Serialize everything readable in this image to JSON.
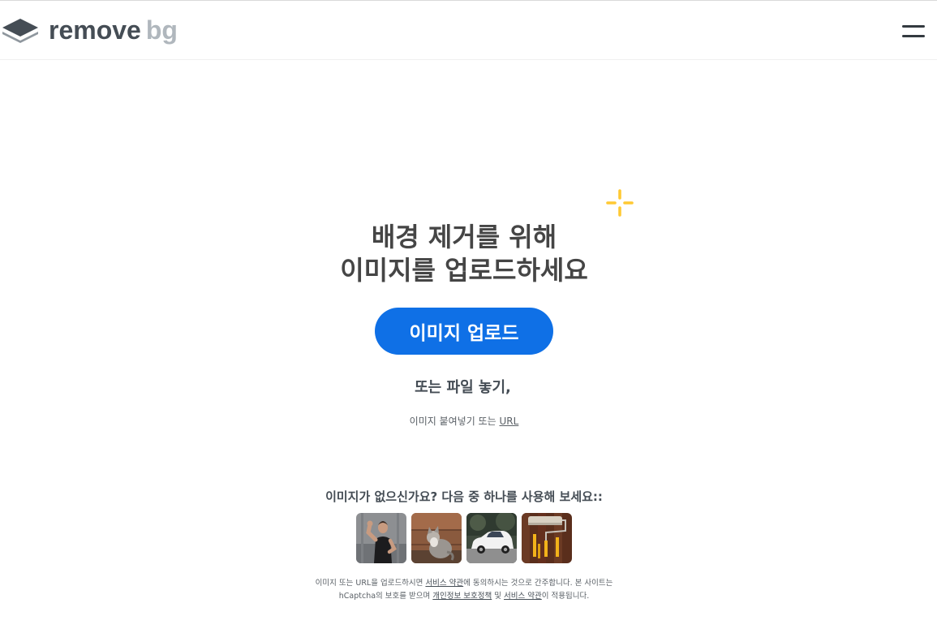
{
  "header": {
    "logo_word1": "remove",
    "logo_word2": "bg",
    "menu_icon": "hamburger-menu-icon"
  },
  "hero": {
    "headline_line1": "배경 제거를 위해",
    "headline_line2": "이미지를 업로드하세요",
    "upload_button": "이미지 업로드",
    "drop_text": "또는 파일 놓기,",
    "paste_text": "이미지 붙여넣기 또는",
    "url_link": "URL",
    "sparkle_icon": "sparkle-icon"
  },
  "samples": {
    "title": "이미지가 없으신가요? 다음 중 하나를 사용해 보세요::",
    "items": [
      {
        "icon": "woman-flexing-thumbnail"
      },
      {
        "icon": "cat-thumbnail"
      },
      {
        "icon": "white-car-thumbnail"
      },
      {
        "icon": "paint-roller-thumbnail"
      }
    ]
  },
  "legal": {
    "part1": "이미지 또는 URL을 업로드하시면 ",
    "terms_link": "서비스 약관",
    "part2": "에 동의하시는 것으로 간주합니다. 본 사이트는",
    "part3": "hCaptcha의 보호를 받으며 ",
    "privacy_link": "개인정보 보호정책",
    "part4": " 및 ",
    "terms_link2": "서비스 약관",
    "part5": "이 적용됩니다."
  },
  "colors": {
    "accent": "#0f70e6",
    "sparkle": "#ffc933",
    "text": "#454545",
    "logo_gray": "#b0b7bd"
  }
}
